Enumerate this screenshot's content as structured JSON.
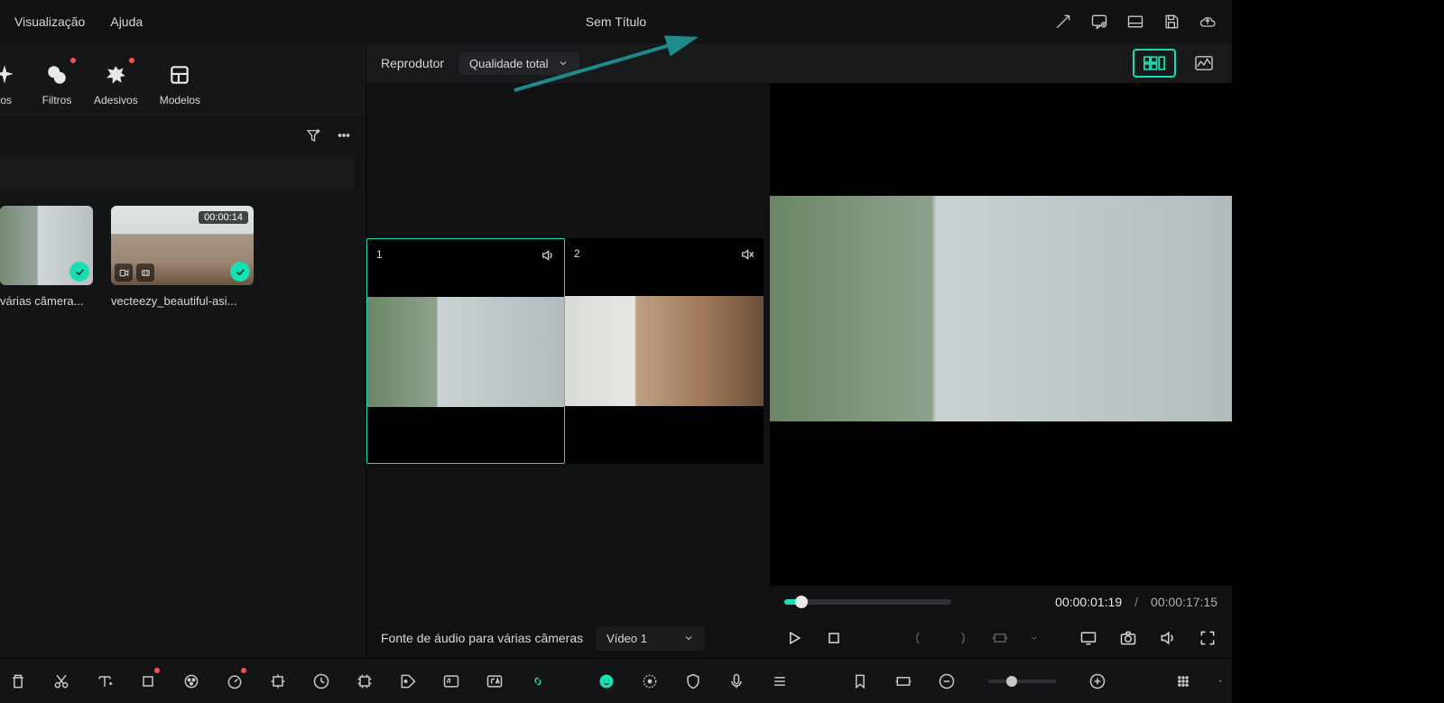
{
  "menubar": {
    "items": [
      "Visualização",
      "Ajuda"
    ],
    "title": "Sem Título"
  },
  "asset_tabs": {
    "items": [
      {
        "label": "tos"
      },
      {
        "label": "Filtros",
        "reddot": true
      },
      {
        "label": "Adesivos",
        "reddot": true
      },
      {
        "label": "Modelos"
      }
    ]
  },
  "media": {
    "items": [
      {
        "label": "várias câmera...",
        "duration": ""
      },
      {
        "label": "vecteezy_beautiful-asi...",
        "duration": "00:00:14"
      }
    ]
  },
  "preview": {
    "player_label": "Reprodutor",
    "quality": "Qualidade total",
    "cams": [
      {
        "num": "1",
        "sound_on": true
      },
      {
        "num": "2",
        "sound_on": false
      }
    ],
    "audio_source_label": "Fonte de áudio para várias câmeras",
    "audio_source_value": "Vídeo 1",
    "time_current": "00:00:01:19",
    "time_sep": "/",
    "time_total": "00:00:17:15"
  }
}
